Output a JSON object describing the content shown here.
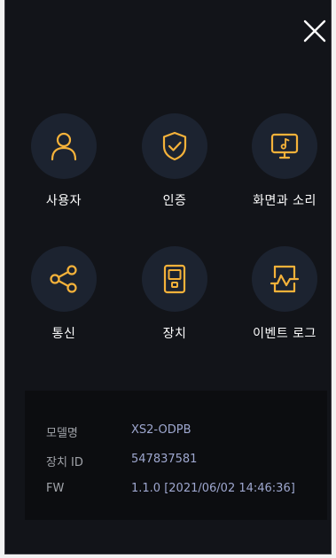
{
  "colors": {
    "background": "#121419",
    "icon_circle": "#1c2330",
    "accent": "#f5b23a",
    "label": "#ffffff",
    "info_label": "#a0a3a9",
    "info_value": "#9ea7cf"
  },
  "header": {
    "close_icon": "close-icon"
  },
  "menu": [
    {
      "label": "사용자",
      "icon": "user-icon"
    },
    {
      "label": "인증",
      "icon": "shield-check-icon"
    },
    {
      "label": "화면과 소리",
      "icon": "display-music-icon"
    },
    {
      "label": "통신",
      "icon": "share-icon"
    },
    {
      "label": "장치",
      "icon": "device-icon"
    },
    {
      "label": "이벤트 로그",
      "icon": "chart-image-icon"
    }
  ],
  "device_info": {
    "model_label": "모델명",
    "model_value": "XS2-ODPB",
    "id_label": "장치 ID",
    "id_value": "547837581",
    "fw_label": "FW",
    "fw_value": "1.1.0 [2021/06/02 14:46:36]"
  }
}
